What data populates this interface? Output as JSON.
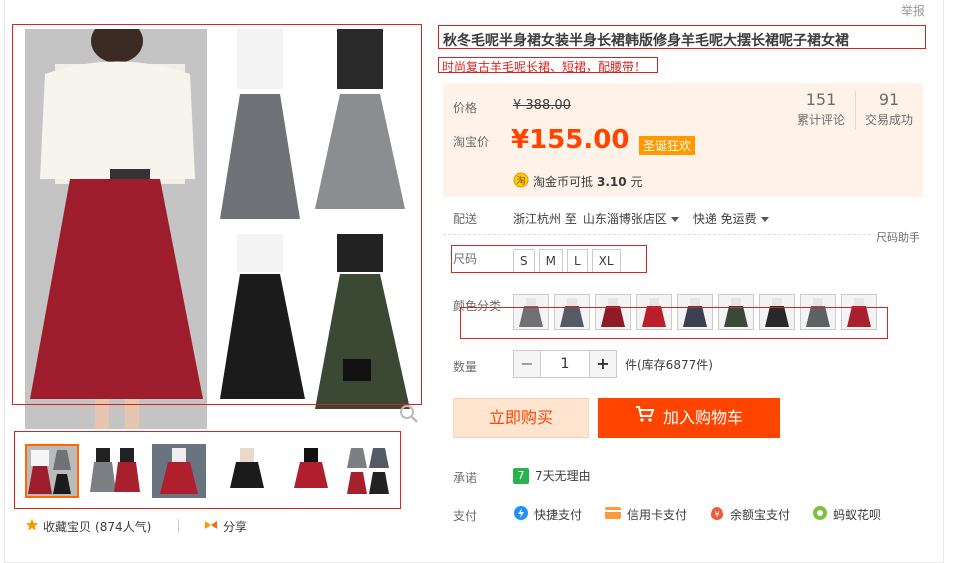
{
  "report_label": "举报",
  "product": {
    "title": "秋冬毛呢半身裙女装半身长裙韩版修身羊毛呢大摆长裙呢子裙女裙",
    "subtitle": "时尚复古羊毛呢长裙、短裙，配腰带！"
  },
  "price": {
    "label": "价格",
    "old_price": "¥ 388.00",
    "taobao_label": "淘宝价",
    "new_price": "¥155.00",
    "promo_badge": "圣诞狂欢",
    "reviews_count": "151",
    "reviews_label": "累计评论",
    "sales_count": "91",
    "sales_label": "交易成功",
    "coin_prefix": "淘金币可抵",
    "coin_value": "3.10",
    "coin_suffix": "元"
  },
  "shipping": {
    "label": "配送",
    "from": "浙江杭州 至",
    "to": "山东淄博张店区",
    "method": "快递 免运费"
  },
  "size_help": "尺码助手",
  "size": {
    "label": "尺码",
    "options": [
      "S",
      "M",
      "L",
      "XL"
    ]
  },
  "color": {
    "label": "颜色分类",
    "swatches": [
      "#6f7176",
      "#545a66",
      "#8f1b27",
      "#b91e2b",
      "#3b4050",
      "#3a4a36",
      "#282828",
      "#5d6166",
      "#a81f2e"
    ]
  },
  "quantity": {
    "label": "数量",
    "minus": "−",
    "value": "1",
    "plus": "+",
    "stock": "件(库存6877件)"
  },
  "buttons": {
    "buy_now": "立即购买",
    "add_cart": "加入购物车"
  },
  "promise": {
    "label": "承诺",
    "badge": "7",
    "text": "7天无理由"
  },
  "payment": {
    "label": "支付",
    "items": [
      "快捷支付",
      "信用卡支付",
      "余额宝支付",
      "蚂蚁花呗"
    ]
  },
  "favorite": {
    "text": "收藏宝贝",
    "count": "(874人气)"
  },
  "share": "分享",
  "colors": {
    "accent": "#ff4400",
    "promo": "#ff9900",
    "red_outline": "#d9231c"
  }
}
